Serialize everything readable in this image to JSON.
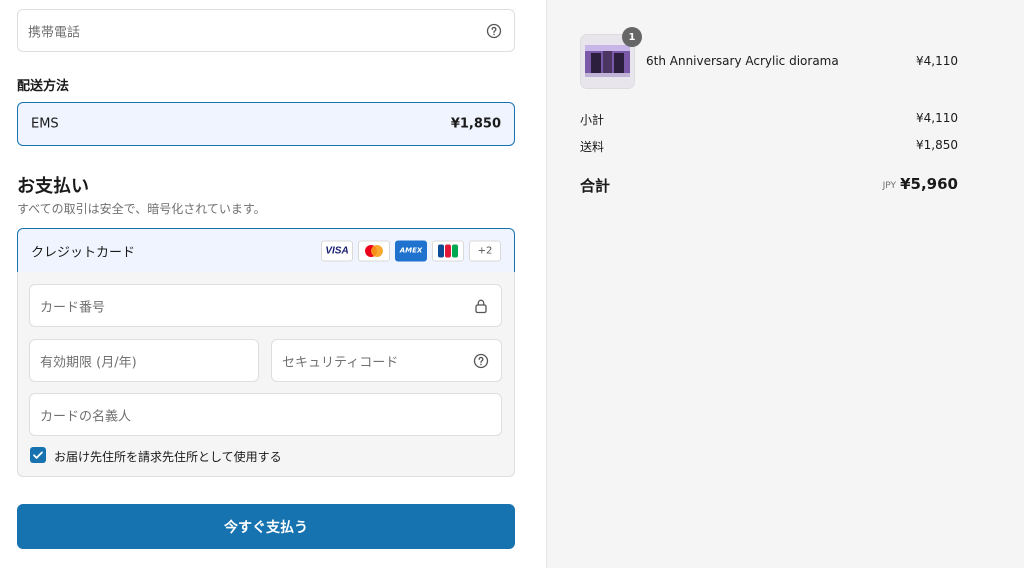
{
  "contact": {
    "phone_placeholder": "携帯電話"
  },
  "shipping": {
    "heading": "配送方法",
    "method_name": "EMS",
    "method_price": "¥1,850"
  },
  "payment": {
    "title": "お支払い",
    "subtitle": "すべての取引は安全で、暗号化されています。",
    "method_label": "クレジットカード",
    "card_brands": [
      "VISA",
      "Mastercard",
      "AMEX",
      "JCB"
    ],
    "more_brands": "+2",
    "card_number_placeholder": "カード番号",
    "expiry_placeholder": "有効期限 (月/年)",
    "security_code_placeholder": "セキュリティコード",
    "cardholder_placeholder": "カードの名義人",
    "billing_same_label": "お届け先住所を請求先住所として使用する",
    "billing_same_checked": true,
    "pay_button": "今すぐ支払う"
  },
  "summary": {
    "item": {
      "name": "6th Anniversary Acrylic diorama",
      "price": "¥4,110",
      "quantity": "1"
    },
    "subtotal_label": "小計",
    "subtotal_value": "¥4,110",
    "shipping_label": "送料",
    "shipping_value": "¥1,850",
    "total_label": "合計",
    "total_currency": "JPY",
    "total_value": "¥5,960"
  },
  "colors": {
    "accent": "#1773b0",
    "selected_bg": "#f0f4ff",
    "sidebar_bg": "#f5f5f5"
  }
}
